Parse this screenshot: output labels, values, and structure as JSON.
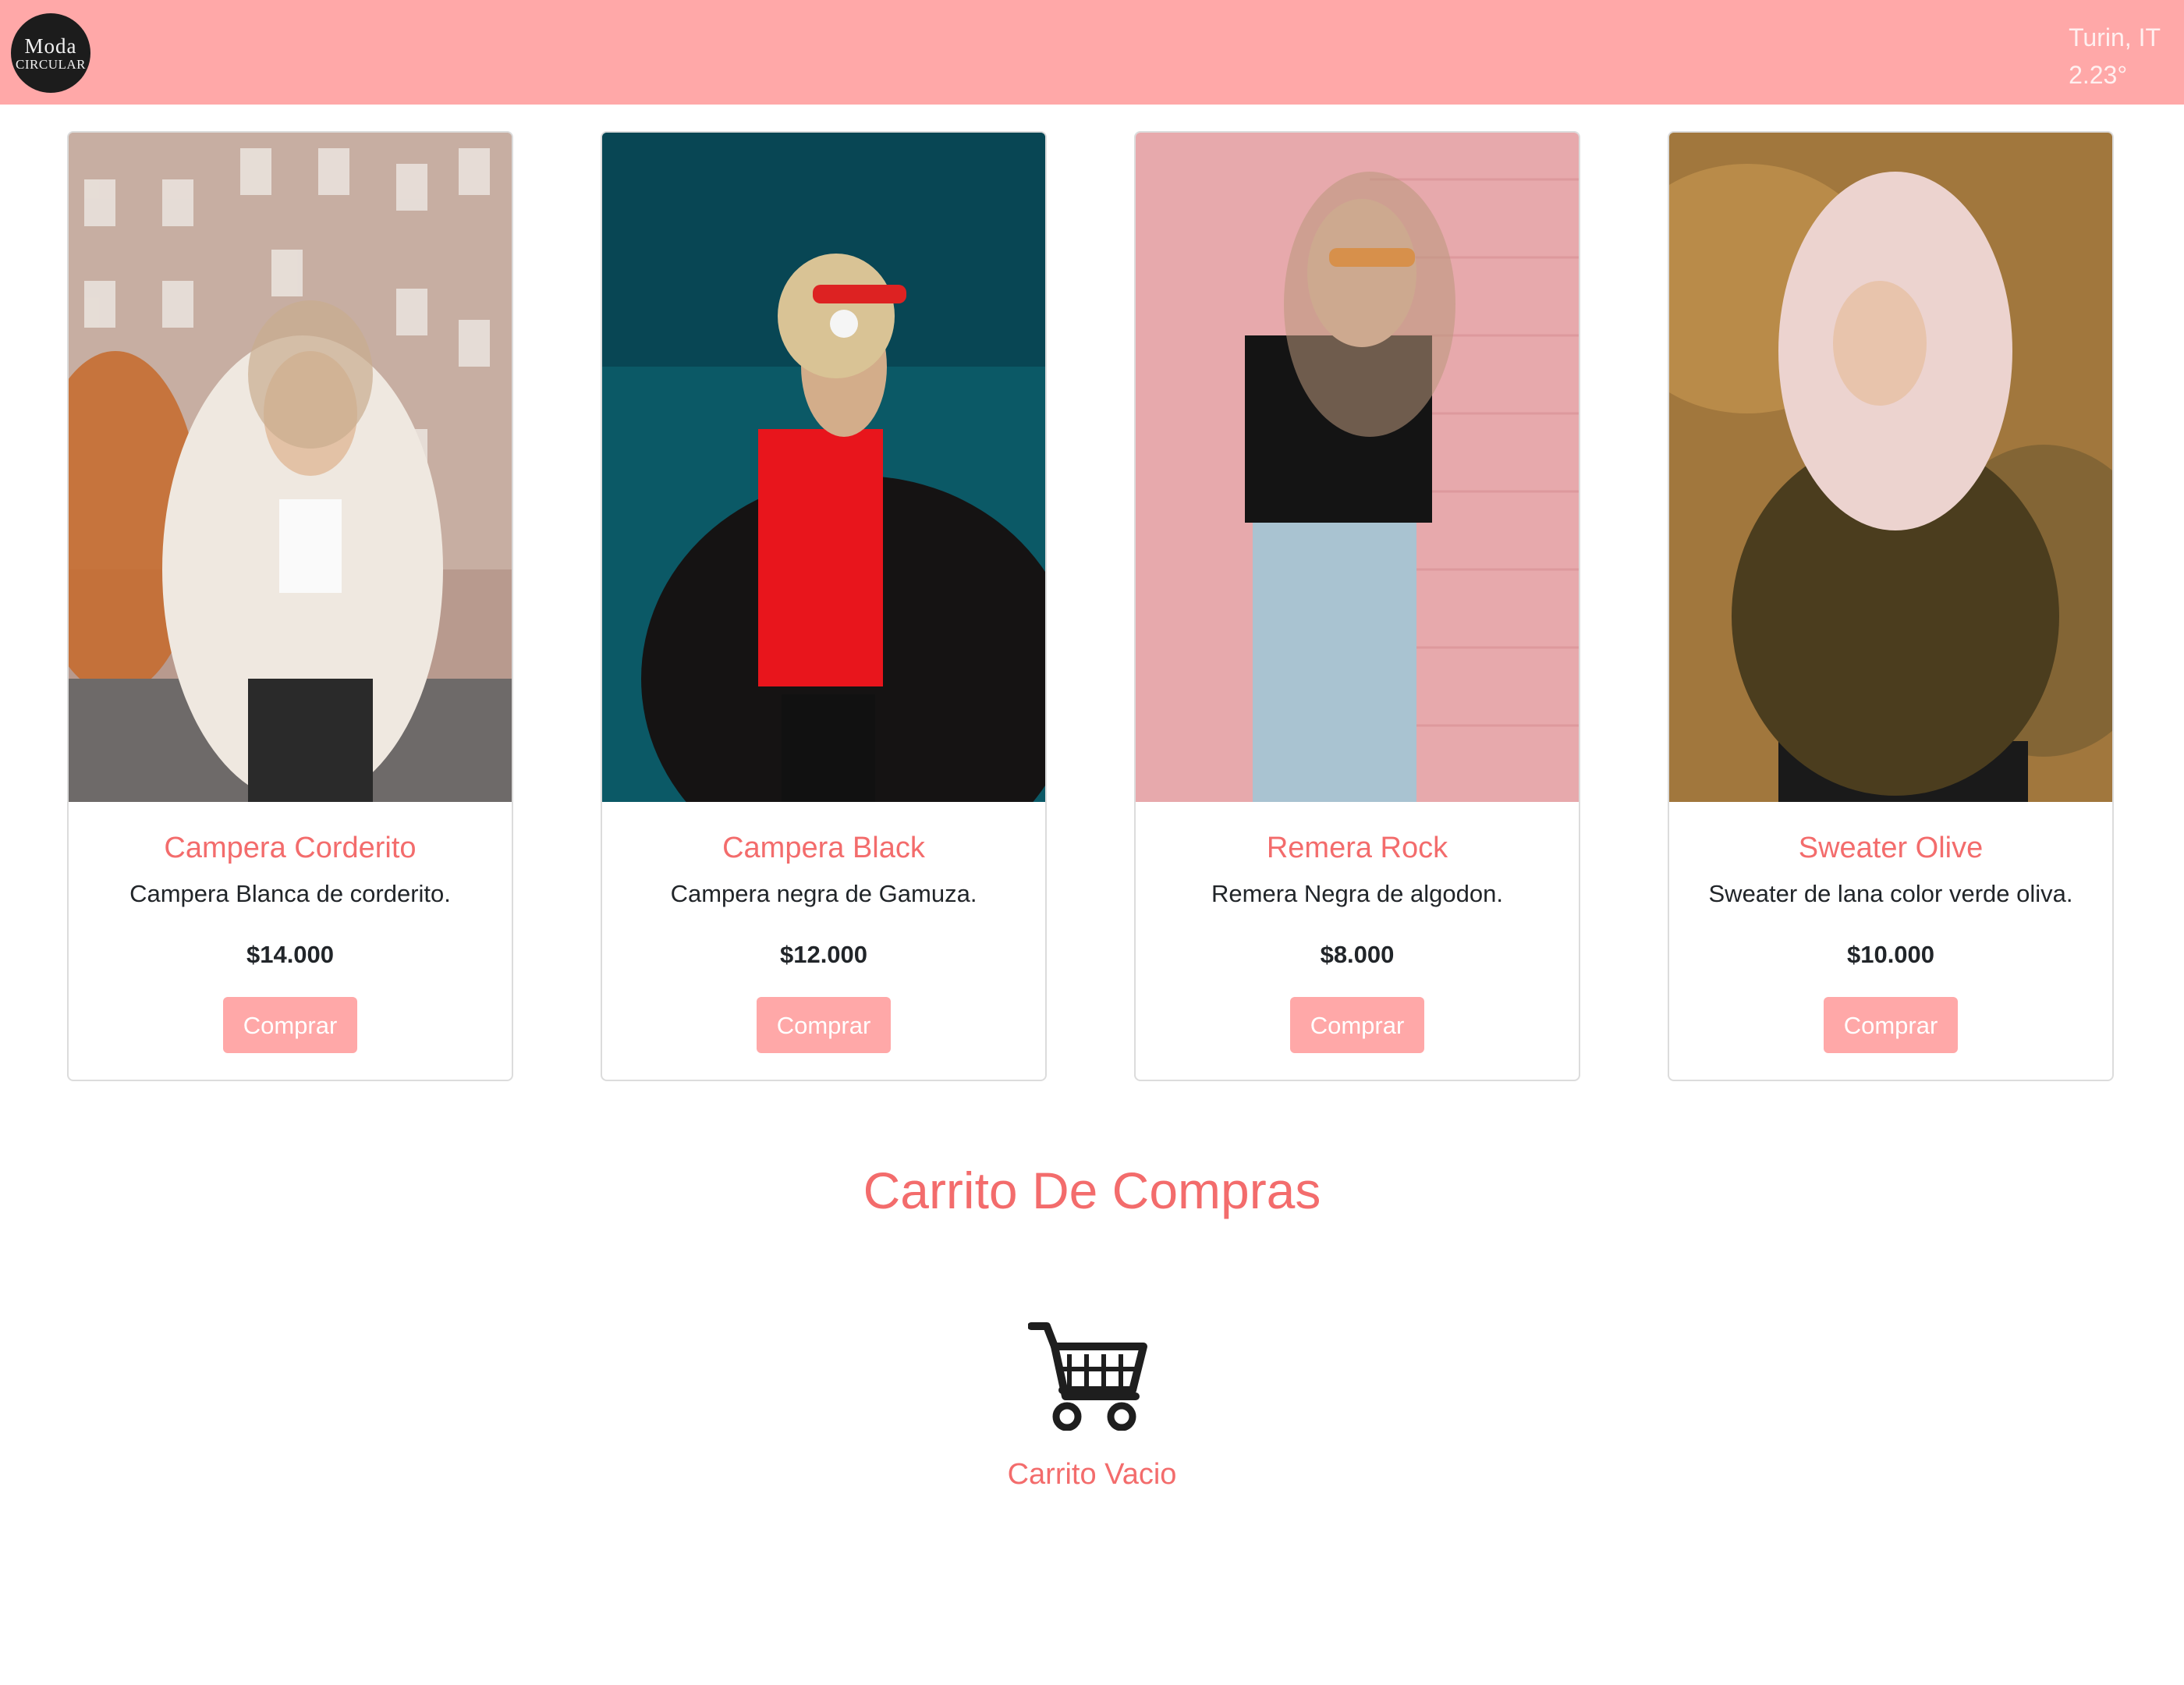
{
  "header": {
    "logo": {
      "line1": "Moda",
      "line2": "CIRCULAR"
    },
    "weather": {
      "city": "Turin, IT",
      "temp": "2.23°"
    }
  },
  "products": [
    {
      "title": "Campera Corderito",
      "desc": "Campera Blanca de corderito.",
      "price": "$14.000",
      "button": "Comprar"
    },
    {
      "title": "Campera Black",
      "desc": "Campera negra de Gamuza.",
      "price": "$12.000",
      "button": "Comprar"
    },
    {
      "title": "Remera Rock",
      "desc": "Remera Negra de algodon.",
      "price": "$8.000",
      "button": "Comprar"
    },
    {
      "title": "Sweater Olive",
      "desc": "Sweater de lana color verde oliva.",
      "price": "$10.000",
      "button": "Comprar"
    }
  ],
  "cart": {
    "title": "Carrito De Compras",
    "icon": "shopping-cart-icon",
    "empty_label": "Carrito Vacio"
  },
  "colors": {
    "navbar": "#ffa8a8",
    "accent_text": "#f36c6c",
    "button": "#ffa8a8"
  }
}
